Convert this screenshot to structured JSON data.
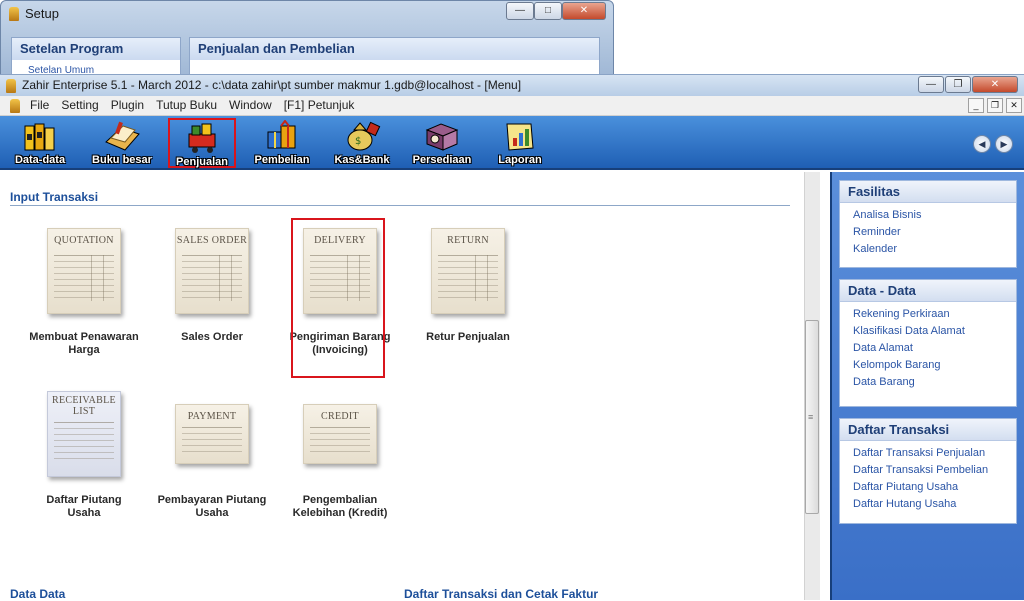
{
  "setup_window": {
    "title": "Setup",
    "left_panel_title": "Setelan Program",
    "left_panel_link": "Setelan Umum",
    "right_panel_title": "Penjualan dan Pembelian"
  },
  "main_window": {
    "title": "Zahir Enterprise 5.1 - March 2012 - c:\\data zahir\\pt sumber makmur 1.gdb@localhost - [Menu]"
  },
  "menu": {
    "items": [
      "File",
      "Setting",
      "Plugin",
      "Tutup Buku",
      "Window",
      "[F1] Petunjuk"
    ]
  },
  "toolbar": {
    "items": [
      {
        "label": "Data-data",
        "icon": "folders-icon"
      },
      {
        "label": "Buku besar",
        "icon": "ledger-book-icon"
      },
      {
        "label": "Penjualan",
        "icon": "sales-cart-icon",
        "selected": true
      },
      {
        "label": "Pembelian",
        "icon": "purchase-gifts-icon"
      },
      {
        "label": "Kas&Bank",
        "icon": "money-bag-icon"
      },
      {
        "label": "Persediaan",
        "icon": "inventory-box-icon"
      },
      {
        "label": "Laporan",
        "icon": "report-chart-icon"
      }
    ],
    "nav_prev": "◀",
    "nav_next": "▶"
  },
  "content": {
    "section_title": "Input Transaksi",
    "docs": [
      {
        "header": "QUOTATION",
        "label": "Membuat Penawaran Harga"
      },
      {
        "header": "SALES ORDER",
        "label": "Sales Order"
      },
      {
        "header": "DELIVERY",
        "label": "Pengiriman Barang (Invoicing)"
      },
      {
        "header": "RETURN",
        "label": "Retur Penjualan"
      },
      {
        "header": "RECEIVABLE LIST",
        "label": "Daftar Piutang Usaha"
      },
      {
        "header": "PAYMENT",
        "label": "Pembayaran Piutang Usaha"
      },
      {
        "header": "CREDIT",
        "label": "Pengembalian Kelebihan (Kredit)"
      }
    ],
    "sub_left": "Data Data",
    "sub_right": "Daftar Transaksi dan Cetak Faktur"
  },
  "sidebar": {
    "fasilitas": {
      "title": "Fasilitas",
      "links": [
        "Analisa Bisnis",
        "Reminder",
        "Kalender"
      ]
    },
    "data": {
      "title": "Data - Data",
      "links": [
        "Rekening Perkiraan",
        "Klasifikasi Data Alamat",
        "Data Alamat",
        "Kelompok Barang",
        "Data Barang"
      ]
    },
    "daftar": {
      "title": "Daftar Transaksi",
      "links": [
        "Daftar Transaksi Penjualan",
        "Daftar Transaksi Pembelian",
        "Daftar Piutang Usaha",
        "Daftar Hutang Usaha"
      ]
    }
  },
  "colors": {
    "toolbar": "#2f74cf",
    "sidebar": "#4a7fd3",
    "highlight": "#d9151c",
    "link": "#2b55a6",
    "heading": "#1d4f9a"
  }
}
